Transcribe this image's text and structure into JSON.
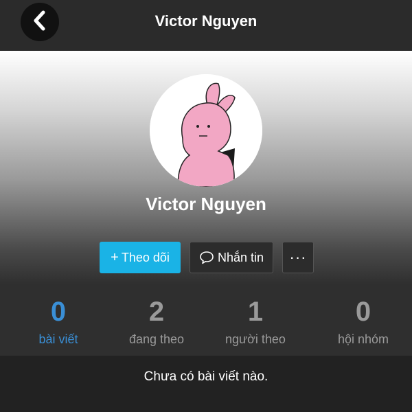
{
  "header": {
    "title": "Victor Nguyen",
    "back_icon": "chevron-left-icon"
  },
  "profile": {
    "name": "Victor Nguyen",
    "avatar": "pink-rabbit-avatar"
  },
  "actions": {
    "follow_icon": "+",
    "follow_label": "Theo dõi",
    "message_icon": "chat-bubble-icon",
    "message_label": "Nhắn tin",
    "more_label": "···"
  },
  "stats": [
    {
      "value": "0",
      "label": "bài viết",
      "active": true
    },
    {
      "value": "2",
      "label": "đang theo",
      "active": false
    },
    {
      "value": "1",
      "label": "người theo",
      "active": false
    },
    {
      "value": "0",
      "label": "hội nhóm",
      "active": false
    }
  ],
  "empty_message": "Chưa có bài viết nào.",
  "colors": {
    "accent": "#1ab3e6",
    "active_stat": "#3a8fd6",
    "inactive_stat": "#9a9a9a",
    "header_bg": "#2b2b2b"
  }
}
